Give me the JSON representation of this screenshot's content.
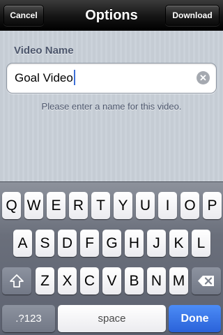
{
  "navbar": {
    "title": "Options",
    "cancel_label": "Cancel",
    "download_label": "Download"
  },
  "form": {
    "section_label": "Video Name",
    "video_name_value": "Goal Video",
    "hint": "Please enter a name for this video."
  },
  "keyboard": {
    "row1": [
      "Q",
      "W",
      "E",
      "R",
      "T",
      "Y",
      "U",
      "I",
      "O",
      "P"
    ],
    "row2": [
      "A",
      "S",
      "D",
      "F",
      "G",
      "H",
      "J",
      "K",
      "L"
    ],
    "row3": [
      "Z",
      "X",
      "C",
      "V",
      "B",
      "N",
      "M"
    ],
    "numbers_label": ".?123",
    "space_label": "space",
    "done_label": "Done",
    "shift_icon": "shift-icon",
    "backspace_icon": "backspace-icon"
  },
  "colors": {
    "navbar": "#000000",
    "done_key": "#2f6ee0",
    "label_text": "#4c566c",
    "caret": "#3d6fd6"
  }
}
